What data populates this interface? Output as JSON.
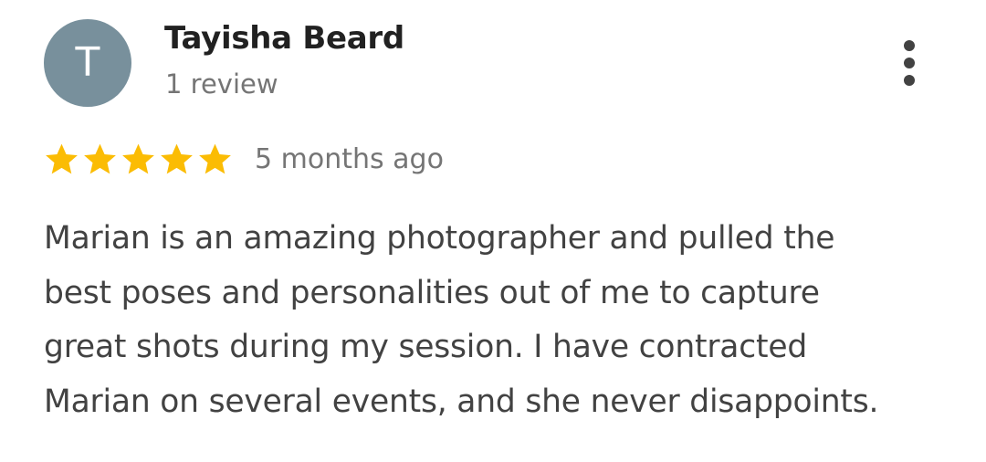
{
  "review": {
    "avatar": {
      "initial": "T",
      "color": "#78909c"
    },
    "reviewer_name": "Tayisha Beard",
    "review_count": "1 review",
    "more_options_icon": "vertical-dots-icon",
    "rating": {
      "stars": 5,
      "max_stars": 5,
      "star_color": "#fbbc04"
    },
    "time_ago": "5 months ago",
    "text_lines": [
      "Marian is an amazing photographer and pulled the",
      "best poses and personalities out of me to capture",
      "great shots during my session. I have contracted",
      "Marian on several events, and she never disappoints."
    ]
  }
}
